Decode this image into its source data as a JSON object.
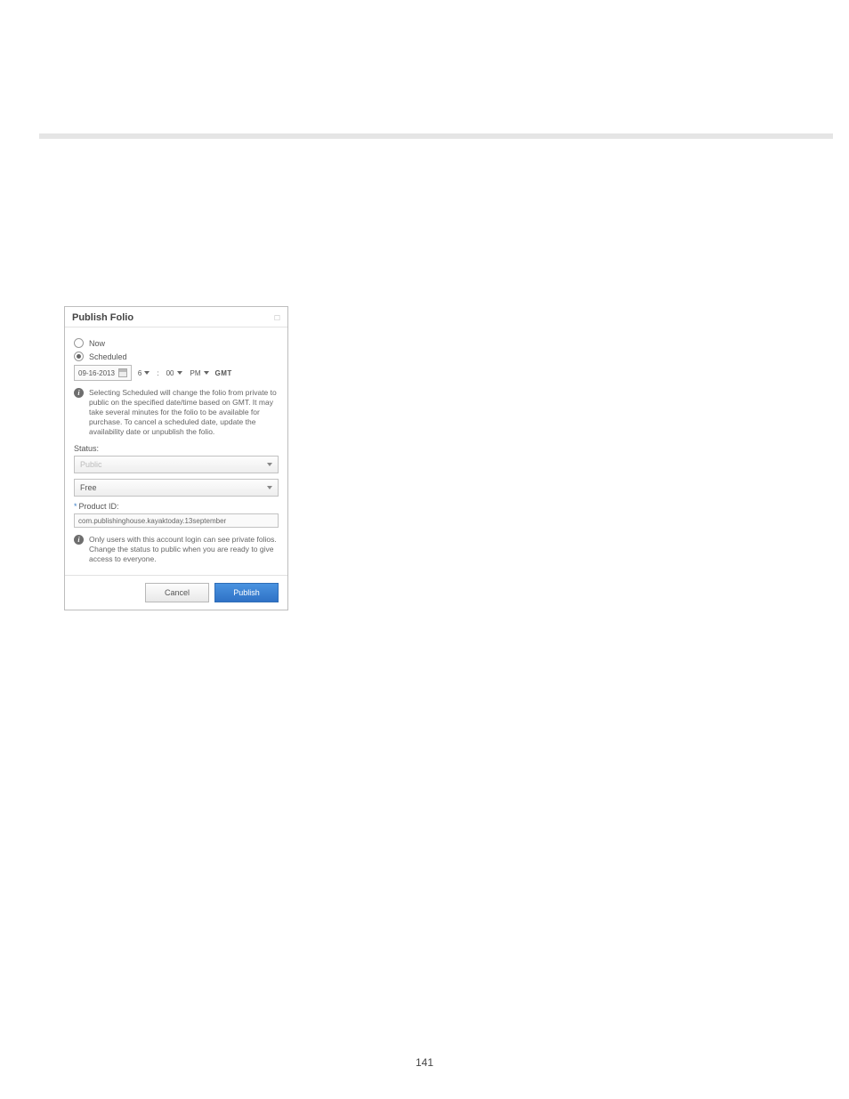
{
  "page": {
    "number": "141"
  },
  "dialog": {
    "title": "Publish Folio",
    "radio_now": "Now",
    "radio_scheduled": "Scheduled",
    "date": "09-16-2013",
    "hour": "6",
    "minute": "00",
    "ampm": "PM",
    "timezone": "GMT",
    "colon": ":",
    "info_scheduled": "Selecting Scheduled will change the folio from private to public on the specified date/time based on GMT. It may take several minutes for the folio to be available for purchase. To cancel a scheduled date, update the availability date or unpublish the folio.",
    "status_label": "Status:",
    "status_value": "Public",
    "price_value": "Free",
    "product_id_label": "Product ID:",
    "product_id_value": "com.publishinghouse.kayaktoday.13september",
    "info_private": "Only users with this account login can see private folios. Change the status to public when you are ready to give access to everyone.",
    "cancel": "Cancel",
    "publish": "Publish",
    "info_glyph": "i",
    "req_marker": "*"
  }
}
